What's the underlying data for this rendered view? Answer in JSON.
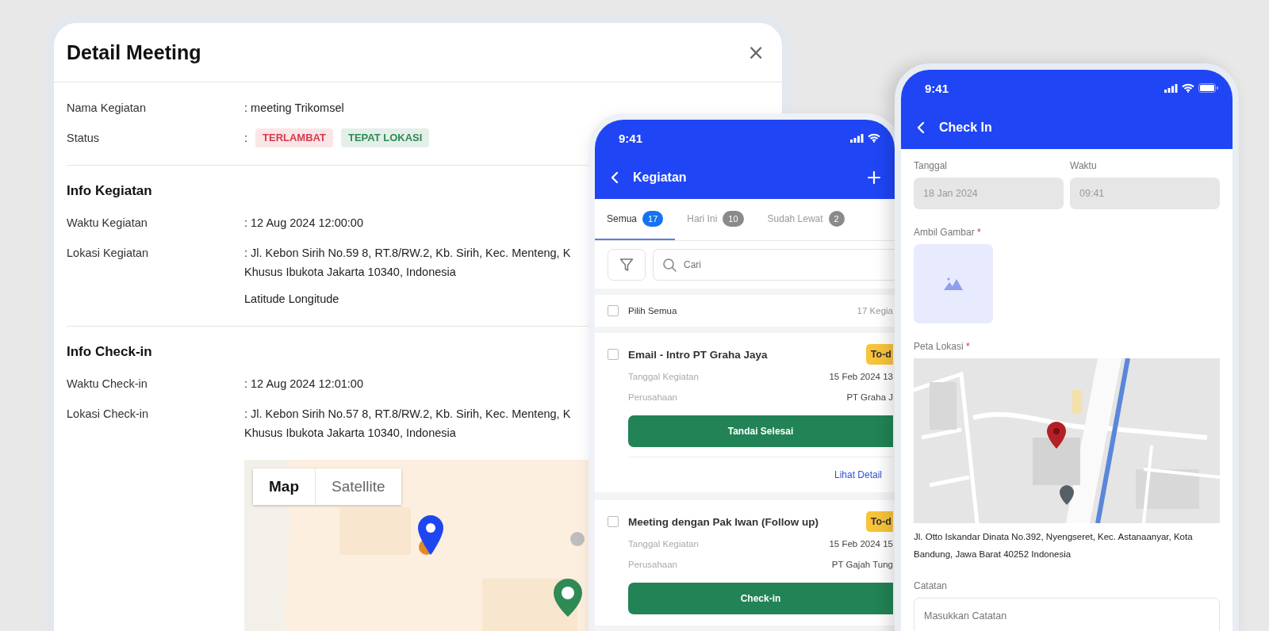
{
  "detail_panel": {
    "title": "Detail Meeting",
    "close": "×",
    "sections": [
      {
        "fields": [
          {
            "kind": "text",
            "label": "Nama Kegiatan",
            "lines": [
              ": meeting Trikomsel"
            ]
          },
          {
            "kind": "tags",
            "label": "Status",
            "prefix": ":",
            "tags": [
              {
                "text": "TERLAMBAT",
                "color": "#d63a4a"
              },
              {
                "text": "TEPAT LOKASI",
                "color": "#2f8a55"
              }
            ]
          }
        ]
      },
      {
        "heading": "Info Kegiatan",
        "fields": [
          {
            "kind": "text",
            "label": "Waktu Kegiatan",
            "lines": [
              ": 12 Aug 2024 12:00:00"
            ]
          },
          {
            "kind": "text",
            "label": "Lokasi Kegiatan",
            "lines": [
              ": Jl. Kebon Sirih No.59 8, RT.8/RW.2, Kb. Sirih, Kec. Menteng, K",
              "Khusus Ibukota Jakarta 10340, Indonesia"
            ],
            "note": "Latitude Longitude"
          }
        ]
      },
      {
        "heading": "Info Check-in",
        "fields": [
          {
            "kind": "text",
            "label": "Waktu Check-in",
            "lines": [
              ": 12 Aug 2024 12:01:00"
            ]
          },
          {
            "kind": "text",
            "label": "Lokasi Check-in",
            "lines": [
              ": Jl. Kebon Sirih No.57 8, RT.8/RW.2, Kb. Sirih, Kec. Menteng, K",
              "Khusus Ibukota Jakarta 10340, Indonesia"
            ]
          }
        ],
        "map": {
          "kind": "picture",
          "toggle": [
            {
              "label": "Map",
              "selected": true
            },
            {
              "label": "Satellite",
              "selected": false
            }
          ]
        }
      }
    ]
  },
  "activity_phone": {
    "time": "9:41",
    "title": "Kegiatan",
    "tabs": [
      {
        "label": "Semua",
        "count": "17",
        "selected": true
      },
      {
        "label": "Hari Ini",
        "count": "10",
        "selected": false
      },
      {
        "label": "Sudah Lewat",
        "count": "2",
        "selected": false
      }
    ],
    "search": {
      "placeholder": "Cari"
    },
    "select_all": {
      "label": "Pilih Semua",
      "checked": false,
      "count": "17 Kegia"
    },
    "items": [
      {
        "title": "Email - Intro PT Graha Jaya",
        "checked": false,
        "badge": "To-d",
        "fields": [
          {
            "label": "Tanggal Kegiatan",
            "value": "15 Feb 2024 13"
          },
          {
            "label": "Perusahaan",
            "value": "PT Graha J"
          }
        ],
        "action": "Tandai Selesai",
        "link": "Lihat Detail"
      },
      {
        "title": "Meeting dengan Pak Iwan (Follow up)",
        "checked": false,
        "badge": "To-d",
        "fields": [
          {
            "label": "Tanggal Kegiatan",
            "value": "15 Feb 2024 15"
          },
          {
            "label": "Perusahaan",
            "value": "PT Gajah Tung"
          }
        ],
        "action": "Check-in"
      }
    ]
  },
  "checkin_phone": {
    "time": "9:41",
    "title": "Check In",
    "fields": [
      {
        "label": "Tanggal",
        "value": "18 Jan 2024",
        "disabled": true
      },
      {
        "label": "Waktu",
        "value": "09:41",
        "disabled": true
      }
    ],
    "photo": {
      "label": "Ambil Gambar",
      "mark": "*"
    },
    "location": {
      "label": "Peta Lokasi",
      "mark": "*",
      "address": "Jl. Otto Iskandar Dinata No.392, Nyengseret, Kec. Astanaanyar, Kota Bandung, Jawa Barat 40252 Indonesia"
    },
    "notes": {
      "label": "Catatan",
      "placeholder": "Masukkan Catatan"
    }
  }
}
